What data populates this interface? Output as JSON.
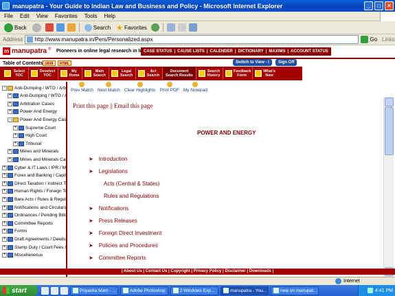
{
  "window": {
    "title": "manupatra - Your Guide to Indian Law and Business and Policy - Microsoft Internet Explorer",
    "controls": [
      "_",
      "□",
      "✕"
    ]
  },
  "menu": [
    "File",
    "Edit",
    "View",
    "Favorites",
    "Tools",
    "Help"
  ],
  "toolbar": {
    "back": "Back",
    "search": "Search",
    "favorites": "Favorites"
  },
  "address": {
    "label": "Address",
    "url": "http://www.manupatra.in/Pers/Personalized.aspx",
    "go": "Go",
    "links": "Links"
  },
  "site": {
    "logo": "manupatra",
    "registered": "®",
    "tagline": "Pioneers in online legal research in India",
    "topnav": [
      "CASE STATUS",
      "CAUSE LISTS",
      "CALENDER",
      "DICTIONARY",
      "MAXIMS",
      "ACCOUNT STATUS"
    ],
    "toc_title": "Table of Contents",
    "java_badge": "JAVA",
    "html_badge": "HTML",
    "switch_view": "Switch to View - I",
    "sign_off": "Sign Off"
  },
  "rednav": [
    {
      "label": "Select TOC",
      "icon": "toc-select-icon"
    },
    {
      "label": "Deselect TOC",
      "icon": "toc-deselect-icon"
    },
    {
      "label": "My Home",
      "icon": "home-icon"
    },
    {
      "label": "Main Search",
      "icon": "main-search-icon"
    },
    {
      "label": "Legal Search",
      "icon": "legal-search-icon"
    },
    {
      "label": "Act Search",
      "icon": "act-search-icon"
    },
    {
      "label": "Document Search Results",
      "icon": "document-results-icon"
    },
    {
      "label": "Search History",
      "icon": "history-icon"
    },
    {
      "label": "Feedback Form",
      "icon": "feedback-icon"
    },
    {
      "label": "What's New",
      "icon": "whats-new-icon"
    }
  ],
  "tree": [
    {
      "label": "Anti-Dumping / WTO / Arbitr",
      "level": 0,
      "state": "-"
    },
    {
      "label": "Anti-Dumping / WTO / Arb",
      "level": 1,
      "state": "+"
    },
    {
      "label": "Arbitration Cases",
      "level": 1,
      "state": "+"
    },
    {
      "label": "Power And Energy",
      "level": 1,
      "state": "+"
    },
    {
      "label": "Power And Energy Cases",
      "level": 1,
      "state": "-"
    },
    {
      "label": "Supreme Court",
      "level": 2,
      "state": "+"
    },
    {
      "label": "High Court",
      "level": 2,
      "state": "+"
    },
    {
      "label": "Tribunal",
      "level": 2,
      "state": "+"
    },
    {
      "label": "Mines and Minerals",
      "level": 1,
      "state": "+"
    },
    {
      "label": "Mines and Minerals Cases",
      "level": 1,
      "state": "+"
    },
    {
      "label": "Cyber & IT Laws / IPR / Med",
      "level": 0,
      "state": "+"
    },
    {
      "label": "Forex and Banking / Capital",
      "level": 0,
      "state": "+"
    },
    {
      "label": "Direct Taxation / Indirect Ta",
      "level": 0,
      "state": "+"
    },
    {
      "label": "Human Rights / Foreign Trad",
      "level": 0,
      "state": "+"
    },
    {
      "label": "Bare Acts / Rules & Regulatio",
      "level": 0,
      "state": "+"
    },
    {
      "label": "Notifications and Circulars",
      "level": 0,
      "state": "+"
    },
    {
      "label": "Ordinances / Pending Bills",
      "level": 0,
      "state": "+"
    },
    {
      "label": "Committee Reports",
      "level": 0,
      "state": "+"
    },
    {
      "label": "Forms",
      "level": 0,
      "state": "+"
    },
    {
      "label": "Draft Agreements / Deeds e",
      "level": 0,
      "state": "+"
    },
    {
      "label": "Stamp Duty / Court Fees / C",
      "level": 0,
      "state": "+"
    },
    {
      "label": "Miscellaneous",
      "level": 0,
      "state": "+"
    }
  ],
  "content_tools": [
    "Prev Match",
    "Next Match",
    "Clear Highlights",
    "Print PDF",
    "My Notepad"
  ],
  "content": {
    "print_page": "Print this page",
    "separator": " || ",
    "email_page": "Email this page",
    "title": "POWER AND ENERGY",
    "links": [
      {
        "label": "Introduction",
        "arrow": true
      },
      {
        "label": "Legislations",
        "arrow": true
      },
      {
        "label": "Acts (Central & States)",
        "arrow": false
      },
      {
        "label": "Rules and Regulations",
        "arrow": false
      },
      {
        "label": "Notifications",
        "arrow": true
      },
      {
        "label": "Press Releases",
        "arrow": true
      },
      {
        "label": "Foreign Direct Investment",
        "arrow": true
      },
      {
        "label": "Policies and Procedures",
        "arrow": true
      },
      {
        "label": "Committee Reports",
        "arrow": true
      }
    ]
  },
  "footer": "| About Us | Contact Us | Copyright | Privacy Policy | Disclaimer | Downloads |",
  "status": {
    "zone": "Internet"
  },
  "taskbar": {
    "start": "start",
    "tasks": [
      "Priyanka Mam - ...",
      "Adobe Photoshop",
      "2 Windows Exp...",
      "manupatra - You...",
      "new on manupat..."
    ],
    "active_task": 3,
    "clock": "4:41 PM"
  }
}
